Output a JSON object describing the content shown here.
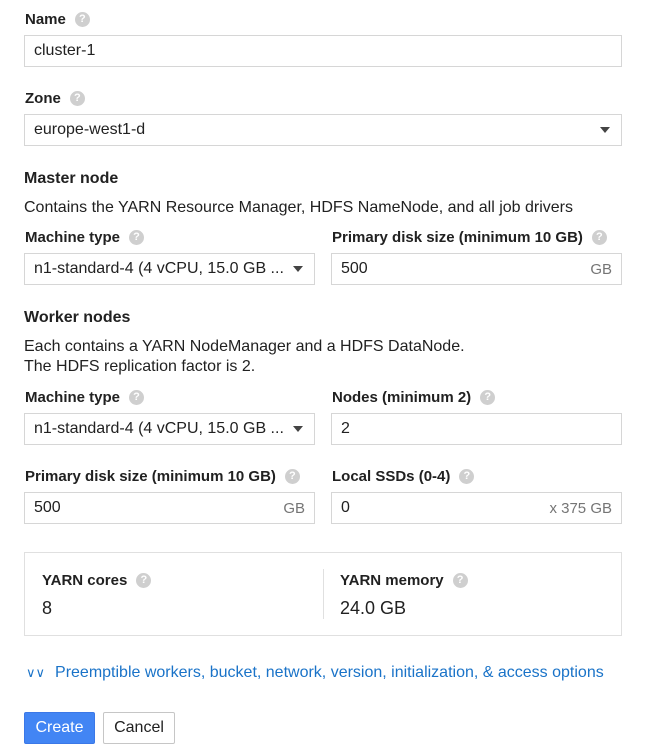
{
  "name": {
    "label": "Name",
    "value": "cluster-1"
  },
  "zone": {
    "label": "Zone",
    "value": "europe-west1-d"
  },
  "master": {
    "title": "Master node",
    "description": "Contains the YARN Resource Manager, HDFS NameNode, and all job drivers",
    "machine_type_label": "Machine type",
    "machine_type_value": "n1-standard-4 (4 vCPU, 15.0 GB ...",
    "disk_label": "Primary disk size (minimum 10 GB)",
    "disk_value": "500",
    "disk_unit": "GB"
  },
  "workers": {
    "title": "Worker nodes",
    "description_line1": "Each contains a YARN NodeManager and a HDFS DataNode.",
    "description_line2": "The HDFS replication factor is 2.",
    "machine_type_label": "Machine type",
    "machine_type_value": "n1-standard-4 (4 vCPU, 15.0 GB ...",
    "nodes_label": "Nodes (minimum 2)",
    "nodes_value": "2",
    "disk_label": "Primary disk size (minimum 10 GB)",
    "disk_value": "500",
    "disk_unit": "GB",
    "ssd_label": "Local SSDs (0-4)",
    "ssd_value": "0",
    "ssd_unit": "x 375 GB"
  },
  "summary": {
    "cores_label": "YARN cores",
    "cores_value": "8",
    "memory_label": "YARN memory",
    "memory_value": "24.0 GB"
  },
  "more_options_link": "Preemptible workers, bucket, network, version, initialization, & access options",
  "buttons": {
    "create": "Create",
    "cancel": "Cancel"
  },
  "help_glyph": "?",
  "expand_glyph": "∨∨",
  "colors": {
    "primary": "#4285f4",
    "link": "#1a73c8",
    "help_icon": "#cfcfcf",
    "border": "#d6d6d6"
  }
}
